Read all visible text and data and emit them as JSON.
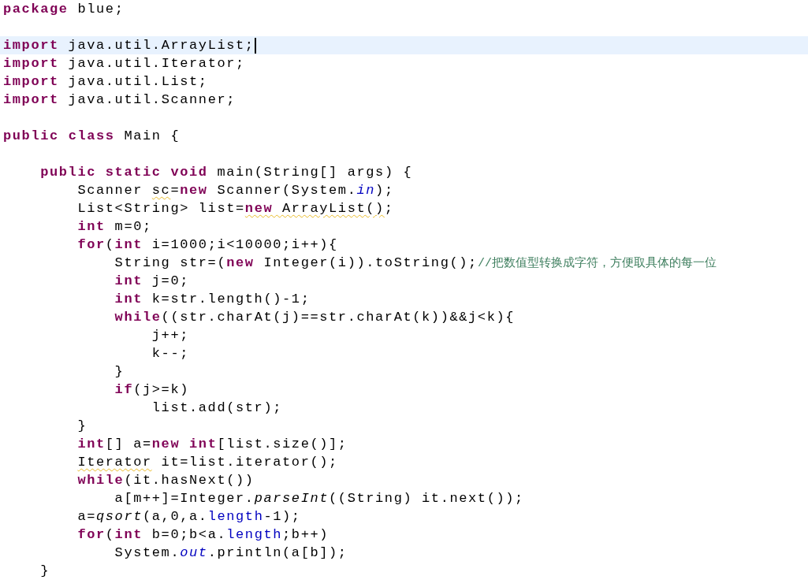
{
  "editor": {
    "lines": [
      {
        "kind": "code",
        "current": false,
        "tokens": [
          {
            "kind": "keyword",
            "text": "package"
          },
          {
            "kind": "plain",
            "text": " blue;"
          }
        ]
      },
      {
        "kind": "blank",
        "current": false
      },
      {
        "kind": "code",
        "current": true,
        "tokens": [
          {
            "kind": "keyword",
            "text": "import"
          },
          {
            "kind": "plain",
            "text": " java.util.ArrayList;"
          }
        ]
      },
      {
        "kind": "code",
        "current": false,
        "tokens": [
          {
            "kind": "keyword",
            "text": "import"
          },
          {
            "kind": "plain",
            "text": " java.util.Iterator;"
          }
        ]
      },
      {
        "kind": "code",
        "current": false,
        "tokens": [
          {
            "kind": "keyword",
            "text": "import"
          },
          {
            "kind": "plain",
            "text": " java.util.List;"
          }
        ]
      },
      {
        "kind": "code",
        "current": false,
        "tokens": [
          {
            "kind": "keyword",
            "text": "import"
          },
          {
            "kind": "plain",
            "text": " java.util.Scanner;"
          }
        ]
      },
      {
        "kind": "blank",
        "current": false
      },
      {
        "kind": "code",
        "current": false,
        "tokens": [
          {
            "kind": "keyword",
            "text": "public "
          },
          {
            "kind": "keyword",
            "text": "class"
          },
          {
            "kind": "plain",
            "text": " Main {"
          }
        ],
        "children": [
          {
            "kind": "blank",
            "current": false
          },
          {
            "kind": "code",
            "current": false,
            "tokens": [
              {
                "kind": "keyword",
                "text": "public "
              },
              {
                "kind": "keyword",
                "text": "static "
              },
              {
                "kind": "keyword",
                "text": "void"
              },
              {
                "kind": "plain",
                "text": " main(String[] args) {"
              }
            ],
            "children": [
              {
                "kind": "code",
                "current": false,
                "tokens": [
                  {
                    "kind": "plain",
                    "text": "Scanner "
                  },
                  {
                    "kind": "warning",
                    "tokens": [
                      {
                        "kind": "plain",
                        "text": "sc"
                      }
                    ]
                  },
                  {
                    "kind": "plain",
                    "text": "="
                  },
                  {
                    "kind": "keyword",
                    "text": "new"
                  },
                  {
                    "kind": "plain",
                    "text": " Scanner(System."
                  },
                  {
                    "kind": "static-field",
                    "text": "in"
                  },
                  {
                    "kind": "plain",
                    "text": ");"
                  }
                ]
              },
              {
                "kind": "code",
                "current": false,
                "tokens": [
                  {
                    "kind": "plain",
                    "text": "List<String> list="
                  },
                  {
                    "kind": "warning",
                    "tokens": [
                      {
                        "kind": "keyword",
                        "text": "new"
                      },
                      {
                        "kind": "plain",
                        "text": " ArrayList()"
                      }
                    ]
                  },
                  {
                    "kind": "plain",
                    "text": ";"
                  }
                ]
              },
              {
                "kind": "code",
                "current": false,
                "tokens": [
                  {
                    "kind": "keyword",
                    "text": "int"
                  },
                  {
                    "kind": "plain",
                    "text": " m=0;"
                  }
                ]
              },
              {
                "kind": "code",
                "current": false,
                "tokens": [
                  {
                    "kind": "keyword",
                    "text": "for"
                  },
                  {
                    "kind": "plain",
                    "text": "("
                  },
                  {
                    "kind": "keyword",
                    "text": "int"
                  },
                  {
                    "kind": "plain",
                    "text": " i=1000;i<10000;i++){"
                  }
                ],
                "children": [
                  {
                    "kind": "code",
                    "current": false,
                    "tokens": [
                      {
                        "kind": "plain",
                        "text": "String str=("
                      },
                      {
                        "kind": "keyword",
                        "text": "new"
                      },
                      {
                        "kind": "plain",
                        "text": " Integer(i)).toString();"
                      },
                      {
                        "kind": "comment",
                        "text": "//把数值型转换成字符，方便取具体的每一位"
                      }
                    ]
                  },
                  {
                    "kind": "code",
                    "current": false,
                    "tokens": [
                      {
                        "kind": "keyword",
                        "text": "int"
                      },
                      {
                        "kind": "plain",
                        "text": " j=0;"
                      }
                    ]
                  },
                  {
                    "kind": "code",
                    "current": false,
                    "tokens": [
                      {
                        "kind": "keyword",
                        "text": "int"
                      },
                      {
                        "kind": "plain",
                        "text": " k=str.length()-1;"
                      }
                    ]
                  },
                  {
                    "kind": "code",
                    "current": false,
                    "tokens": [
                      {
                        "kind": "keyword",
                        "text": "while"
                      },
                      {
                        "kind": "plain",
                        "text": "((str.charAt(j)==str.charAt(k))&&j<k){"
                      }
                    ],
                    "children": [
                      {
                        "kind": "code",
                        "current": false,
                        "tokens": [
                          {
                            "kind": "plain",
                            "text": "j++;"
                          }
                        ]
                      },
                      {
                        "kind": "code",
                        "current": false,
                        "tokens": [
                          {
                            "kind": "plain",
                            "text": "k--;"
                          }
                        ]
                      }
                    ]
                  },
                  {
                    "kind": "code",
                    "current": false,
                    "tokens": [
                      {
                        "kind": "plain",
                        "text": "}"
                      }
                    ]
                  },
                  {
                    "kind": "code",
                    "current": false,
                    "tokens": [
                      {
                        "kind": "keyword",
                        "text": "if"
                      },
                      {
                        "kind": "plain",
                        "text": "(j>=k)"
                      }
                    ],
                    "children": [
                      {
                        "kind": "code",
                        "current": false,
                        "tokens": [
                          {
                            "kind": "plain",
                            "text": "list.add(str);"
                          }
                        ]
                      }
                    ]
                  }
                ]
              },
              {
                "kind": "code",
                "current": false,
                "tokens": [
                  {
                    "kind": "plain",
                    "text": "}"
                  }
                ]
              },
              {
                "kind": "code",
                "current": false,
                "tokens": [
                  {
                    "kind": "keyword",
                    "text": "int"
                  },
                  {
                    "kind": "plain",
                    "text": "[] a="
                  },
                  {
                    "kind": "keyword",
                    "text": "new "
                  },
                  {
                    "kind": "keyword",
                    "text": "int"
                  },
                  {
                    "kind": "plain",
                    "text": "[list.size()];"
                  }
                ]
              },
              {
                "kind": "code",
                "current": false,
                "tokens": [
                  {
                    "kind": "warning",
                    "tokens": [
                      {
                        "kind": "plain",
                        "text": "Iterator"
                      }
                    ]
                  },
                  {
                    "kind": "plain",
                    "text": " it=list.iterator();"
                  }
                ]
              },
              {
                "kind": "code",
                "current": false,
                "tokens": [
                  {
                    "kind": "keyword",
                    "text": "while"
                  },
                  {
                    "kind": "plain",
                    "text": "(it.hasNext())"
                  }
                ],
                "children": [
                  {
                    "kind": "code",
                    "current": false,
                    "tokens": [
                      {
                        "kind": "plain",
                        "text": "a[m++]=Integer."
                      },
                      {
                        "kind": "static-method",
                        "text": "parseInt"
                      },
                      {
                        "kind": "plain",
                        "text": "((String) it.next());"
                      }
                    ]
                  }
                ]
              },
              {
                "kind": "code",
                "current": false,
                "tokens": [
                  {
                    "kind": "plain",
                    "text": "a="
                  },
                  {
                    "kind": "static-method",
                    "text": "qsort"
                  },
                  {
                    "kind": "plain",
                    "text": "(a,0,a."
                  },
                  {
                    "kind": "field",
                    "text": "length"
                  },
                  {
                    "kind": "plain",
                    "text": "-1);"
                  }
                ]
              },
              {
                "kind": "code",
                "current": false,
                "tokens": [
                  {
                    "kind": "keyword",
                    "text": "for"
                  },
                  {
                    "kind": "plain",
                    "text": "("
                  },
                  {
                    "kind": "keyword",
                    "text": "int"
                  },
                  {
                    "kind": "plain",
                    "text": " b=0;b<a."
                  },
                  {
                    "kind": "field",
                    "text": "length"
                  },
                  {
                    "kind": "plain",
                    "text": ";b++)"
                  }
                ],
                "children": [
                  {
                    "kind": "code",
                    "current": false,
                    "tokens": [
                      {
                        "kind": "plain",
                        "text": "System."
                      },
                      {
                        "kind": "static-field",
                        "text": "out"
                      },
                      {
                        "kind": "plain",
                        "text": ".println(a[b]);"
                      }
                    ]
                  }
                ]
              }
            ]
          },
          {
            "kind": "code",
            "current": false,
            "tokens": [
              {
                "kind": "plain",
                "text": "}"
              }
            ]
          }
        ]
      }
    ]
  }
}
